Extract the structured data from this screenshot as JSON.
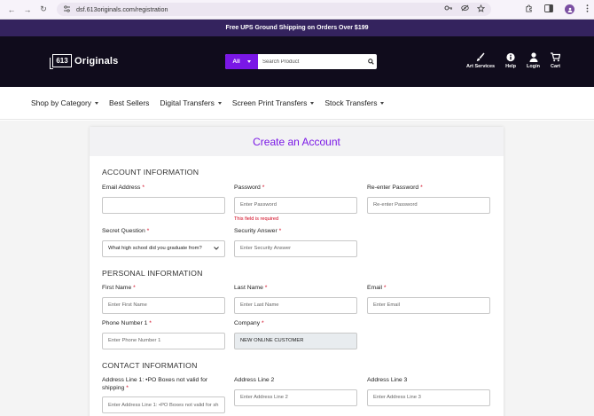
{
  "browser": {
    "url": "dsf.613originals.com/registration",
    "back_glyph": "←",
    "forward_glyph": "→",
    "reload_glyph": "↻"
  },
  "promo": {
    "text": "Free UPS Ground Shipping on Orders Over $199"
  },
  "header": {
    "logo_badge": "613",
    "logo_text": "Originals",
    "search_scope": "All",
    "search_placeholder": "Search Product",
    "icons": [
      {
        "label": "Art Services",
        "icon": "brush-icon"
      },
      {
        "label": "Help",
        "icon": "info-icon"
      },
      {
        "label": "Login",
        "icon": "user-icon"
      },
      {
        "label": "Cart",
        "icon": "cart-icon"
      }
    ]
  },
  "nav": {
    "items": [
      {
        "label": "Shop by Category",
        "dropdown": true
      },
      {
        "label": "Best Sellers",
        "dropdown": false
      },
      {
        "label": "Digital Transfers",
        "dropdown": true
      },
      {
        "label": "Screen Print Transfers",
        "dropdown": true
      },
      {
        "label": "Stock Transfers",
        "dropdown": true
      }
    ]
  },
  "form": {
    "title": "Create an Account",
    "required_mark": "*",
    "sections": {
      "account": "ACCOUNT INFORMATION",
      "personal": "PERSONAL INFORMATION",
      "contact": "CONTACT INFORMATION"
    },
    "fields": {
      "email_address": {
        "label": "Email Address",
        "placeholder": "",
        "value": ""
      },
      "password": {
        "label": "Password",
        "placeholder": "Enter Password",
        "error": "This field is required"
      },
      "reenter_password": {
        "label": "Re-enter Password",
        "placeholder": "Re-enter Password"
      },
      "secret_question": {
        "label": "Secret Question",
        "value": "What high school did you graduate from?"
      },
      "security_answer": {
        "label": "Security Answer",
        "placeholder": "Enter Security Answer"
      },
      "first_name": {
        "label": "First Name",
        "placeholder": "Enter First Name"
      },
      "last_name": {
        "label": "Last Name",
        "placeholder": "Enter Last Name"
      },
      "email": {
        "label": "Email",
        "placeholder": "Enter Email"
      },
      "phone": {
        "label": "Phone Number 1",
        "placeholder": "Enter Phone Number 1"
      },
      "company": {
        "label": "Company",
        "value": "NEW ONLINE CUSTOMER"
      },
      "address1": {
        "label": "Address Line 1: •PO Boxes not valid for shipping",
        "placeholder": "Enter Address Line 1: •PO Boxes not valid for sh"
      },
      "address2": {
        "label": "Address Line 2",
        "placeholder": "Enter Address Line 2"
      },
      "address3": {
        "label": "Address Line 3",
        "placeholder": "Enter Address Line 3"
      }
    }
  },
  "colors": {
    "accent": "#7a17e6",
    "promo_bg": "#34235e",
    "header_bg": "#100c1c",
    "error": "#d0021b"
  }
}
